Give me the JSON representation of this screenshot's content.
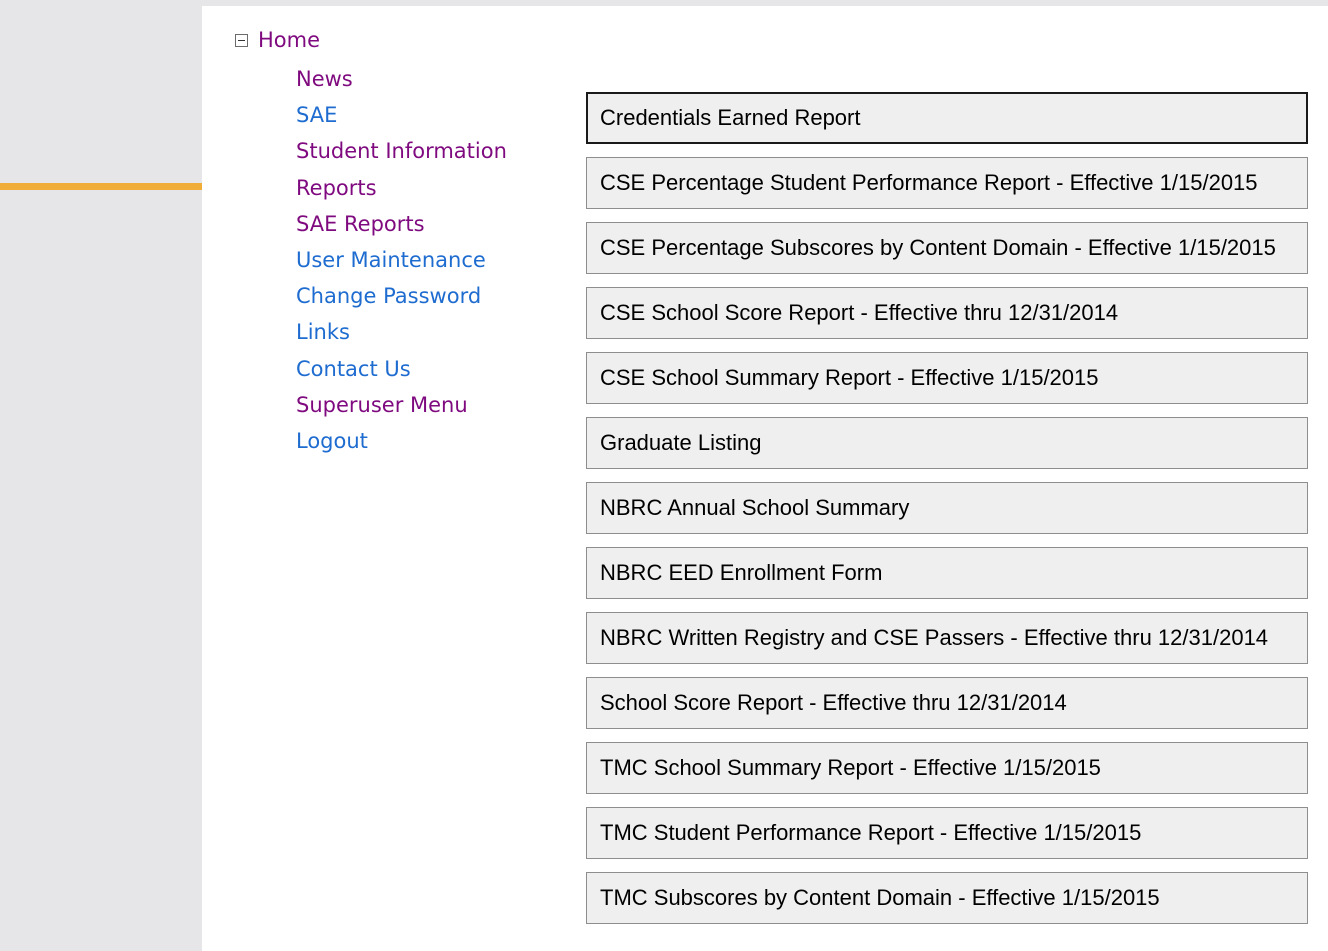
{
  "nav": {
    "home": "Home",
    "items": [
      {
        "label": "News",
        "visited": true
      },
      {
        "label": "SAE",
        "visited": false
      },
      {
        "label": "Student Information",
        "visited": true
      },
      {
        "label": "Reports",
        "visited": true
      },
      {
        "label": "SAE Reports",
        "visited": true
      },
      {
        "label": "User Maintenance",
        "visited": false
      },
      {
        "label": "Change Password",
        "visited": false
      },
      {
        "label": "Links",
        "visited": false
      },
      {
        "label": "Contact Us",
        "visited": false
      },
      {
        "label": "Superuser Menu",
        "visited": true
      },
      {
        "label": "Logout",
        "visited": false
      }
    ]
  },
  "colors": {
    "visited_link": "#7f0a7f",
    "link": "#1e6cd0",
    "arrow": "#f0ad38"
  },
  "reports": [
    "Credentials Earned Report",
    "CSE Percentage Student Performance Report - Effective 1/15/2015",
    "CSE Percentage Subscores by Content Domain - Effective 1/15/2015",
    "CSE School Score Report - Effective thru 12/31/2014",
    "CSE School Summary Report - Effective 1/15/2015",
    "Graduate Listing",
    "NBRC Annual School Summary",
    "NBRC EED Enrollment Form",
    "NBRC Written Registry and CSE Passers - Effective thru 12/31/2014",
    "School Score Report - Effective thru 12/31/2014",
    "TMC School Summary Report - Effective 1/15/2015",
    "TMC Student Performance Report - Effective 1/15/2015",
    "TMC Subscores by Content Domain - Effective 1/15/2015"
  ]
}
